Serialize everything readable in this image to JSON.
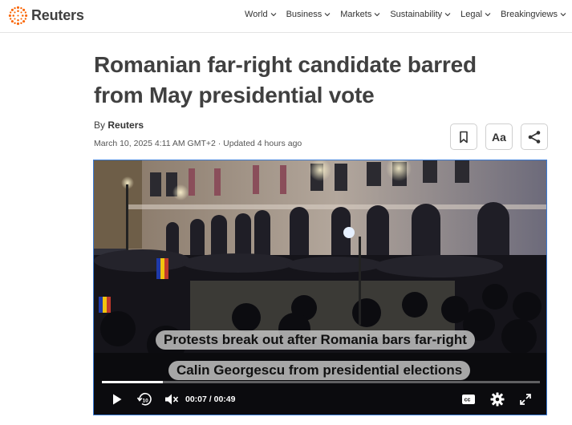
{
  "header": {
    "brand": "Reuters",
    "nav": [
      {
        "label": "World"
      },
      {
        "label": "Business"
      },
      {
        "label": "Markets"
      },
      {
        "label": "Sustainability"
      },
      {
        "label": "Legal"
      },
      {
        "label": "Breakingviews"
      }
    ]
  },
  "article": {
    "title_line1": "Romanian far-right candidate barred",
    "title_line2": "from May presidential vote",
    "by_prefix": "By",
    "author": "Reuters",
    "date": "March 10, 2025 4:11 AM GMT+2 · Updated 4 hours ago",
    "font_size_label": "Aa"
  },
  "video": {
    "caption_line1": "Protests break out after Romania bars far-right",
    "caption_line2": "Calin Georgescu from presidential elections",
    "current_time": "00:07",
    "separator": "/",
    "duration": "00:49",
    "progress_fraction": 0.14,
    "cc_label": "cc",
    "replay_label": "10"
  },
  "icons": [
    "reuters-logo-icon",
    "chevron-down-icon",
    "bookmark-icon",
    "share-icon",
    "play-icon",
    "replay-10-icon",
    "mute-icon",
    "cc-icon",
    "settings-icon",
    "fullscreen-icon"
  ]
}
